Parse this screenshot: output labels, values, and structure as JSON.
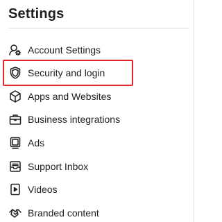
{
  "settings": {
    "title": "Settings",
    "highlight_color": "#e0242c",
    "items": [
      {
        "label": "Account Settings",
        "icon": "account-settings-icon"
      },
      {
        "label": "Security and login",
        "icon": "shield-icon"
      },
      {
        "label": "Apps and Websites",
        "icon": "cube-icon"
      },
      {
        "label": "Business integrations",
        "icon": "briefcase-icon"
      },
      {
        "label": "Ads",
        "icon": "ads-monitor-icon"
      },
      {
        "label": "Support Inbox",
        "icon": "inbox-icon"
      },
      {
        "label": "Videos",
        "icon": "video-icon"
      },
      {
        "label": "Branded content",
        "icon": "handshake-icon"
      }
    ]
  }
}
